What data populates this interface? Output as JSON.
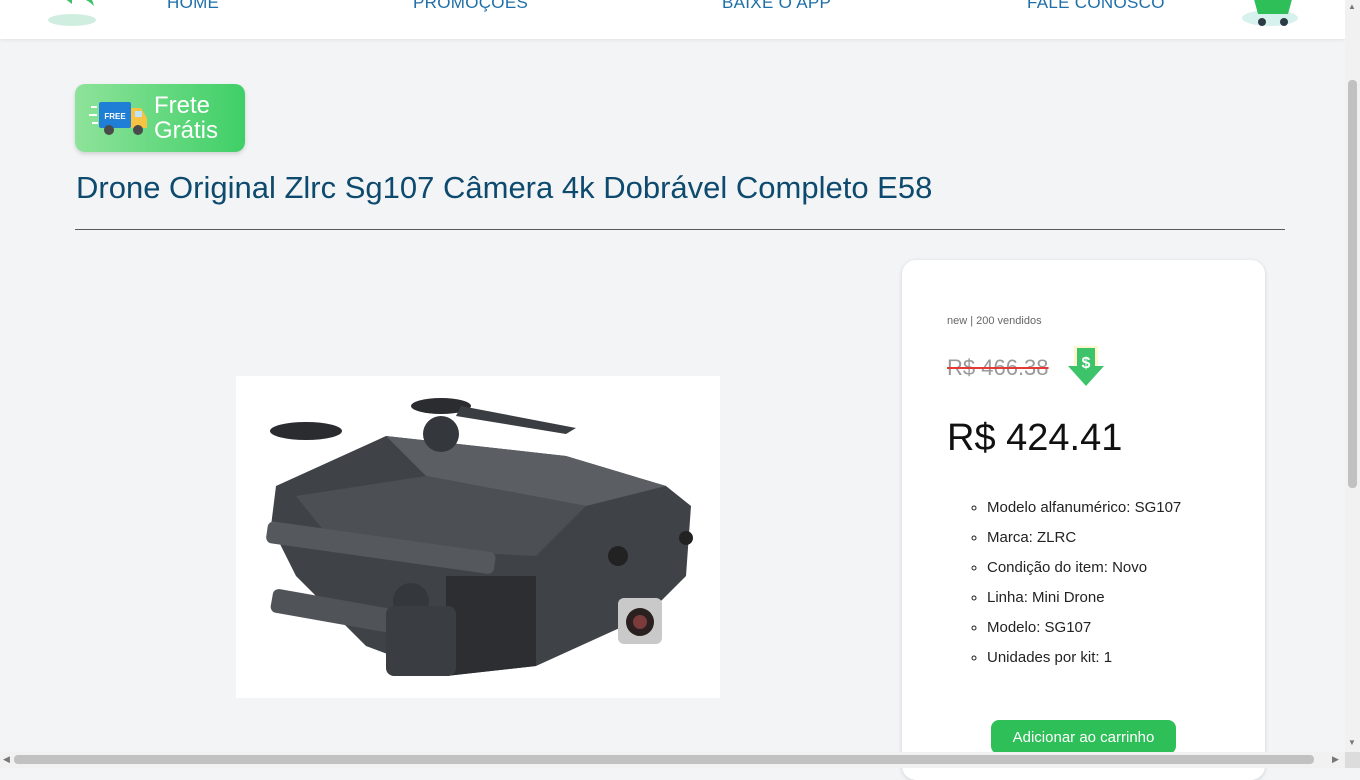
{
  "nav": {
    "items": [
      {
        "label": "HOME"
      },
      {
        "label": "PROMOÇÕES"
      },
      {
        "label": "BAIXE O APP"
      },
      {
        "label": "FALE CONOSCO"
      }
    ],
    "back_icon": "back-arrow-icon",
    "cart_icon": "shopping-cart-icon"
  },
  "badge": {
    "line1": "Frete",
    "line2": "Grátis",
    "truck_text": "FREE",
    "icon": "free-delivery-truck-icon"
  },
  "product": {
    "title": "Drone Original Zlrc Sg107 Câmera 4k Dobrável Completo E58",
    "image": "drone-product-image"
  },
  "card": {
    "meta": "new | 200 vendidos",
    "old_price": "R$ 466.38",
    "price": "R$ 424.41",
    "discount_icon": "price-down-dollar-icon",
    "specs": [
      "Modelo alfanumérico: SG107",
      "Marca: ZLRC",
      "Condição do item: Novo",
      "Linha: Mini Drone",
      "Modelo: SG107",
      "Unidades por kit: 1"
    ],
    "add_button": "Adicionar ao carrinho"
  },
  "colors": {
    "accent_green": "#2fbf58",
    "title_blue": "#0d4a6e",
    "nav_blue": "#1e6fa8"
  }
}
